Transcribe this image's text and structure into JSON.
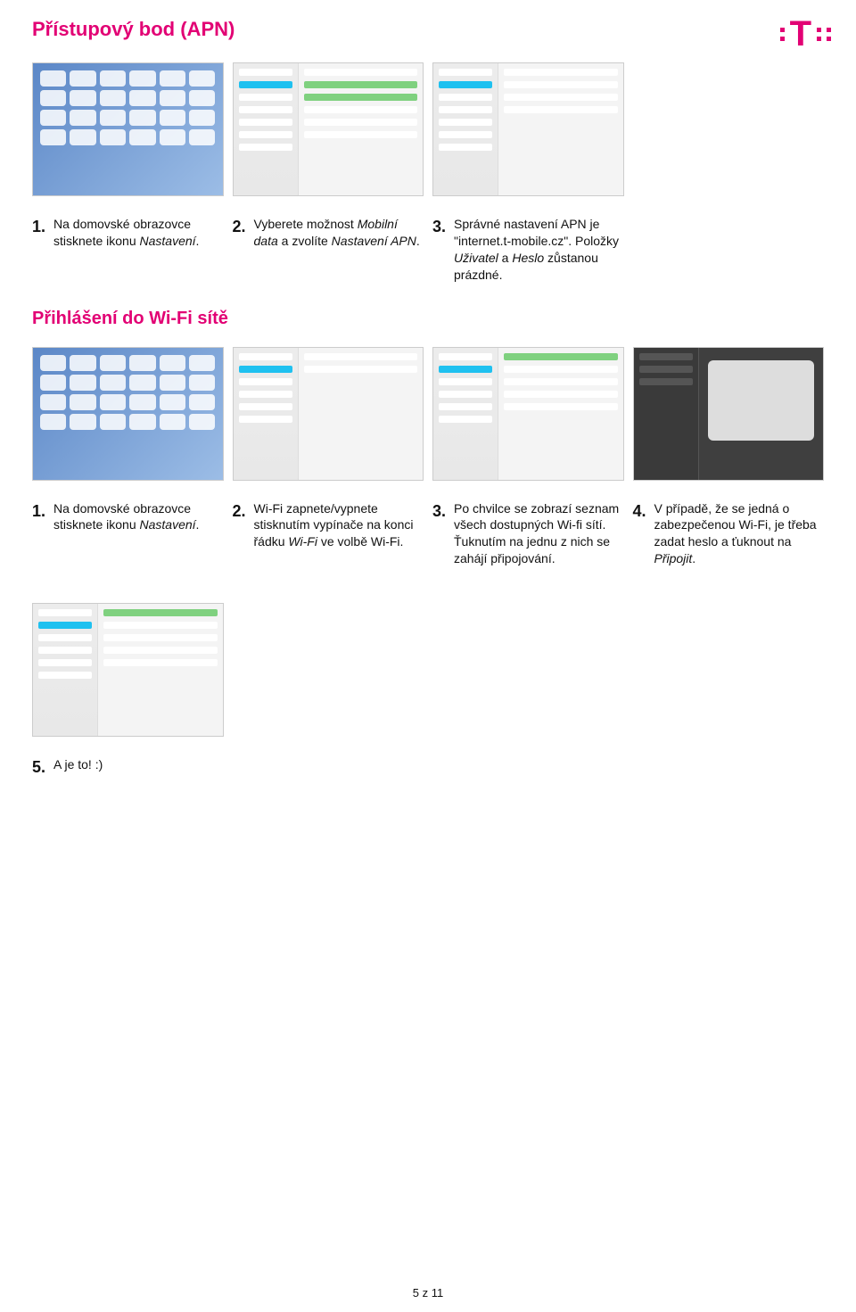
{
  "headings": {
    "h1": "Přístupový bod (APN)",
    "h2": "Přihlášení do Wi-Fi sítě"
  },
  "section1": {
    "steps": [
      {
        "num": "1.",
        "text": "Na domovské obrazovce stisknete ikonu <i>Nastavení</i>."
      },
      {
        "num": "2.",
        "text": "Vyberete možnost <i>Mobilní data</i> a zvolíte <i>Nastavení APN</i>."
      },
      {
        "num": "3.",
        "text": "Správné nastavení APN je \"internet.t-mobile.cz\". Položky <i>Uživatel</i> a <i>Heslo</i> zůstanou prázdné."
      }
    ]
  },
  "section2": {
    "steps": [
      {
        "num": "1.",
        "text": "Na domovské obrazovce stisknete ikonu <i>Nastavení</i>."
      },
      {
        "num": "2.",
        "text": "Wi-Fi zapnete/vypnete stisknutím vypínače na konci řádku <i>Wi-Fi</i> ve volbě Wi-Fi."
      },
      {
        "num": "3.",
        "text": "Po chvilce se zobrazí seznam všech dostupných Wi-fi sítí. Ťuknutím na jednu z nich se zahájí připojování."
      },
      {
        "num": "4.",
        "text": "V případě, že se jedná o zabezpečenou Wi-Fi, je třeba zadat heslo a ťuknout na <i>Připojit</i>."
      }
    ]
  },
  "section3": {
    "steps": [
      {
        "num": "5.",
        "text": "A je to! :)"
      }
    ]
  },
  "footer": "5 z 11"
}
